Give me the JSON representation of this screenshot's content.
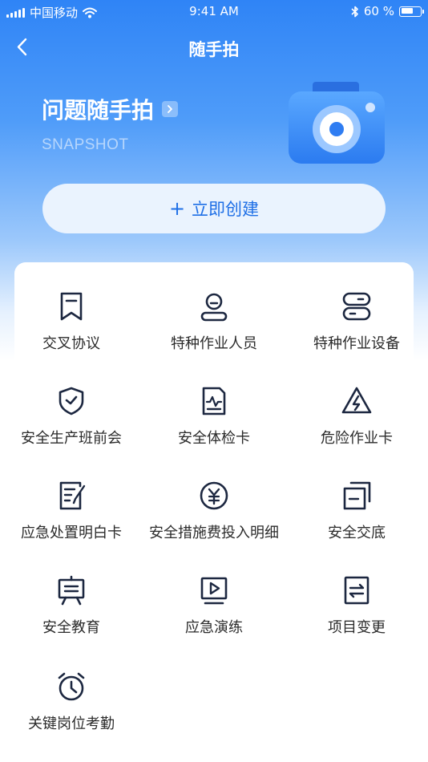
{
  "status_bar": {
    "carrier": "中国移动",
    "time": "9:41 AM",
    "battery": "60 %"
  },
  "nav": {
    "title": "随手拍"
  },
  "hero": {
    "title": "问题随手拍",
    "subtitle": "SNAPSHOT"
  },
  "create_button": {
    "label": "立即创建",
    "plus": "+"
  },
  "grid": [
    {
      "label": "交叉协议",
      "icon": "bookmark-icon"
    },
    {
      "label": "特种作业人员",
      "icon": "person-icon"
    },
    {
      "label": "特种作业设备",
      "icon": "toggle-switch-icon"
    },
    {
      "label": "安全生产班前会",
      "icon": "shield-check-icon"
    },
    {
      "label": "安全体检卡",
      "icon": "health-card-icon"
    },
    {
      "label": "危险作业卡",
      "icon": "warning-lightning-icon"
    },
    {
      "label": "应急处置明白卡",
      "icon": "edit-document-icon"
    },
    {
      "label": "安全措施费投入明细",
      "icon": "yuan-coin-icon"
    },
    {
      "label": "安全交底",
      "icon": "copy-document-icon"
    },
    {
      "label": "安全教育",
      "icon": "presentation-board-icon"
    },
    {
      "label": "应急演练",
      "icon": "play-screen-icon"
    },
    {
      "label": "项目变更",
      "icon": "swap-document-icon"
    },
    {
      "label": "关键岗位考勤",
      "icon": "alarm-clock-icon"
    }
  ],
  "colors": {
    "primary": "#2f84f6",
    "accent": "#1e6fe6",
    "icon_dark": "#1c2740"
  }
}
